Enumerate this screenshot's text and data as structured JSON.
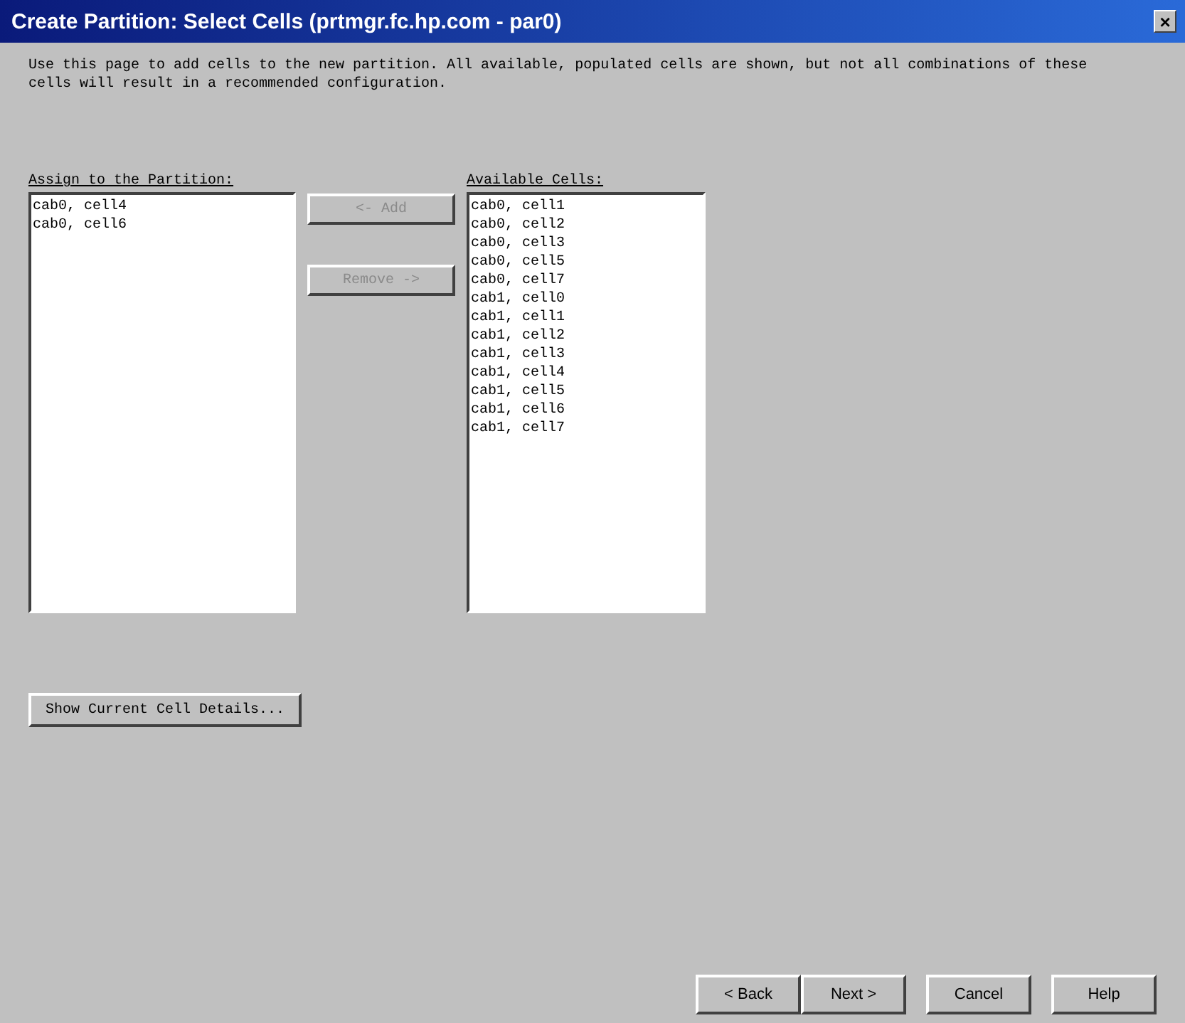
{
  "window": {
    "title": "Create Partition: Select Cells (prtmgr.fc.hp.com - par0)",
    "close": "×"
  },
  "description": "Use this page to add cells to the new partition. All available, populated cells are shown, but not all combinations of these cells will result in a recommended configuration.",
  "assigned": {
    "label": "Assign to the Partition:",
    "items": [
      "cab0, cell4",
      "cab0, cell6"
    ]
  },
  "move_buttons": [
    {
      "label": "<- Add",
      "disabled": true
    },
    {
      "label": "Remove ->",
      "disabled": true
    }
  ],
  "available": {
    "label": "Available Cells:",
    "items": [
      "cab0, cell1",
      "cab0, cell2",
      "cab0, cell3",
      "cab0, cell5",
      "cab0, cell7",
      "cab1, cell0",
      "cab1, cell1",
      "cab1, cell2",
      "cab1, cell3",
      "cab1, cell4",
      "cab1, cell5",
      "cab1, cell6",
      "cab1, cell7"
    ]
  },
  "details_button": "Show Current Cell Details...",
  "footer_buttons": [
    "< Back",
    "Next >",
    "Cancel",
    "Help"
  ]
}
